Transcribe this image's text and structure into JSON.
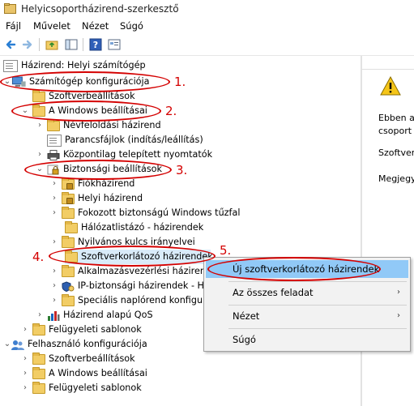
{
  "window": {
    "title": "Helyicsoportházirend-szerkesztő"
  },
  "menu": [
    "Fájl",
    "Művelet",
    "Nézet",
    "Súgó"
  ],
  "tree": {
    "root": "Házirend: Helyi számítógép",
    "computer_config": "Számítógép konfigurációja",
    "software_settings": "Szoftverbeállítások",
    "windows_settings": "A Windows beállításai",
    "name_resolution": "Névfeloldási házirend",
    "scripts": "Parancsfájlok (indítás/leállítás)",
    "deployed_printers": "Központilag telepített nyomtatók",
    "security_settings": "Biztonsági beállítások",
    "account_policies": "Fiókházirend",
    "local_policies": "Helyi házirend",
    "firewall": "Fokozott biztonságú Windows tűzfal",
    "network_list": "Hálózatlistázó - házirendek",
    "public_key": "Nyilvános kulcs irányelvei",
    "srp": "Szoftverkorlátozó házirendek",
    "app_control": "Alkalmazásvezérlési házirend",
    "ipsec": "IP-biztonsági házirendek - He",
    "audit": "Speciális naplórend konfigur",
    "qos": "Házirend alapú QoS",
    "admin_templates": "Felügyeleti sablonok",
    "user_config": "Felhasználó konfigurációja",
    "user_software": "Szoftverbeállítások",
    "user_windows": "A Windows beállításai",
    "user_admin_templates": "Felügyeleti sablonok"
  },
  "right_pane": {
    "line1": "Ebben a",
    "line2": "csoport",
    "line3": "Szoftverk",
    "line4": "Megjegy"
  },
  "context_menu": {
    "new_srp": "Új szoftverkorlátozó házirendek",
    "all_tasks": "Az összes feladat",
    "view": "Nézet",
    "help": "Súgó",
    "submenu_arrow": "›"
  },
  "annotations": [
    "1.",
    "2.",
    "3.",
    "4.",
    "5."
  ],
  "colors": {
    "annotation": "#d40000",
    "highlight": "#91c9f7",
    "selected": "#d9ebf9"
  }
}
